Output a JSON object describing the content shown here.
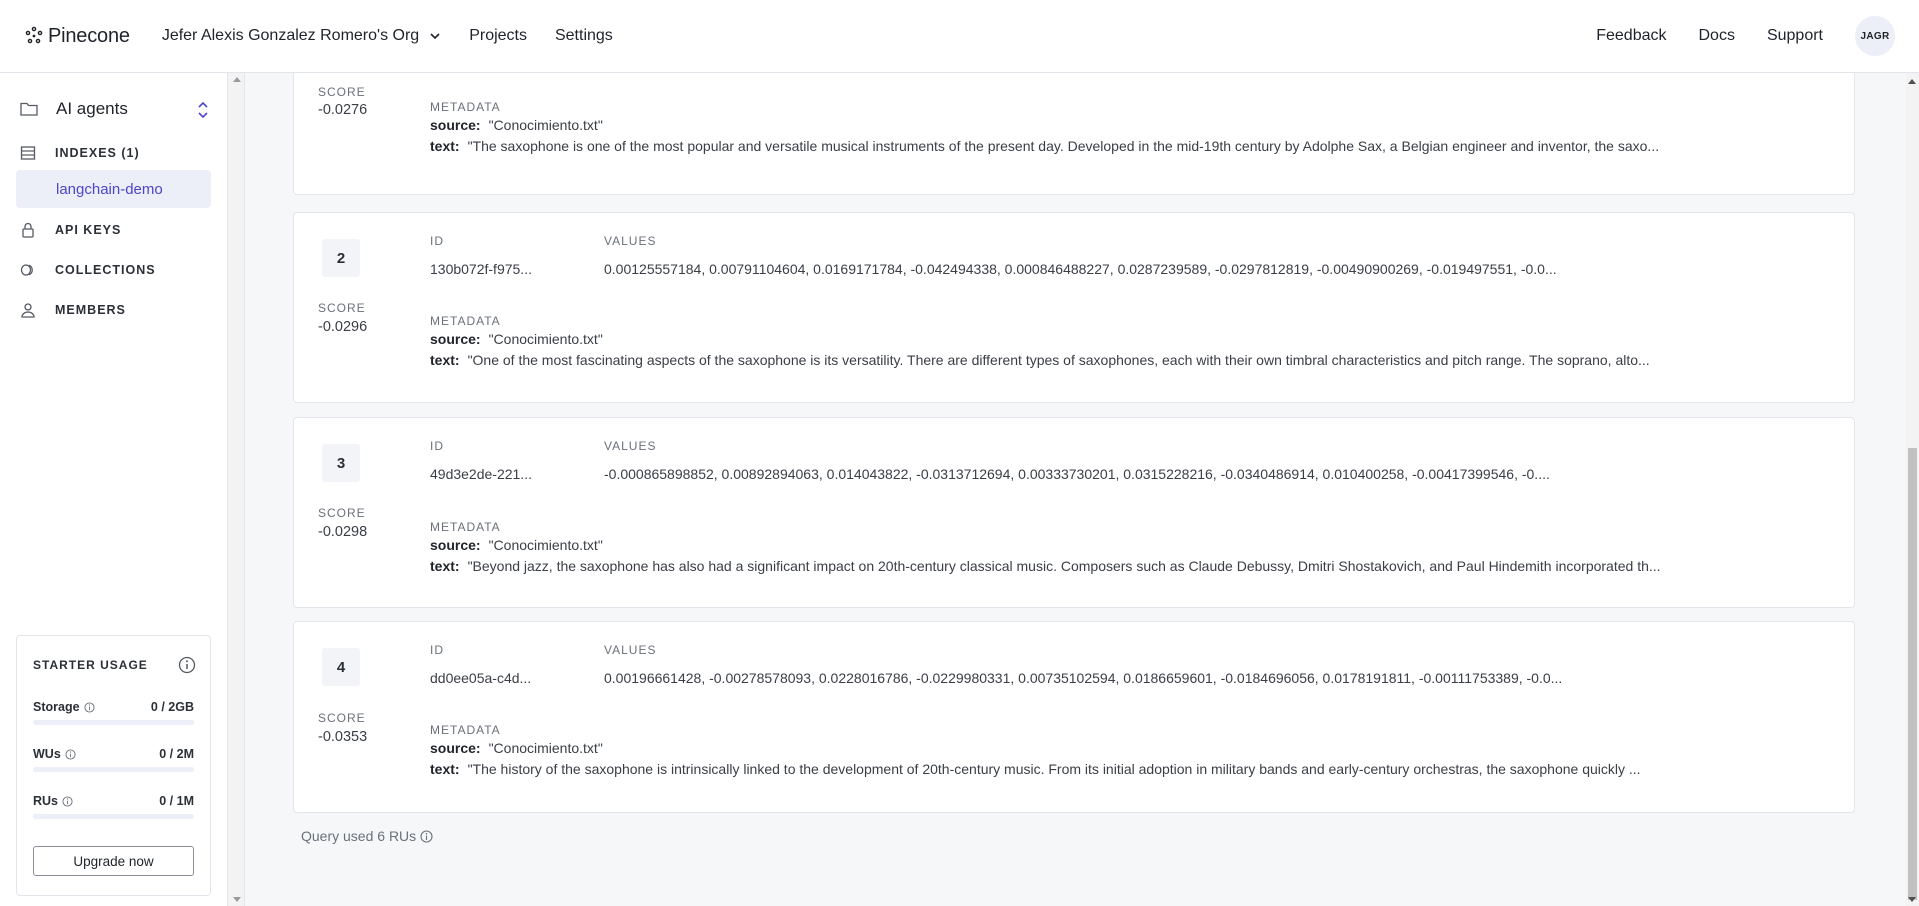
{
  "header": {
    "logo_text": "Pinecone",
    "org_name": "Jefer Alexis Gonzalez Romero's Org",
    "nav": [
      "Projects",
      "Settings"
    ],
    "right_nav": [
      "Feedback",
      "Docs",
      "Support"
    ],
    "avatar_initials": "JAGR"
  },
  "sidebar": {
    "project_name": "AI agents",
    "items": [
      {
        "label": "INDEXES (1)",
        "icon": "table-icon"
      },
      {
        "label": "langchain-demo"
      },
      {
        "label": "API KEYS",
        "icon": "lock-icon"
      },
      {
        "label": "COLLECTIONS",
        "icon": "collections-icon"
      },
      {
        "label": "MEMBERS",
        "icon": "user-icon"
      }
    ],
    "usage": {
      "title": "STARTER USAGE",
      "rows": [
        {
          "label": "Storage",
          "value": "0 / 2GB",
          "fraction": 0
        },
        {
          "label": "WUs",
          "value": "0 / 2M",
          "fraction": 0
        },
        {
          "label": "RUs",
          "value": "0 / 1M",
          "fraction": 0
        }
      ],
      "upgrade_label": "Upgrade now"
    }
  },
  "labels": {
    "score": "SCORE",
    "id": "ID",
    "values": "VALUES",
    "metadata": "METADATA",
    "source": "source:",
    "text": "text:"
  },
  "results": [
    {
      "score": "-0.0276",
      "source": "\"Conocimiento.txt\"",
      "text": "\"The saxophone is one of the most popular and versatile musical instruments of the present day. Developed in the mid-19th century by Adolphe Sax, a Belgian engineer and inventor, the saxo..."
    },
    {
      "rank": "2",
      "score": "-0.0296",
      "id": "130b072f-f975...",
      "values": "0.00125557184, 0.00791104604, 0.0169171784, -0.042494338, 0.000846488227, 0.0287239589, -0.0297812819, -0.00490900269, -0.019497551, -0.0...",
      "source": "\"Conocimiento.txt\"",
      "text": "\"One of the most fascinating aspects of the saxophone is its versatility. There are different types of saxophones, each with their own timbral characteristics and pitch range. The soprano, alto..."
    },
    {
      "rank": "3",
      "score": "-0.0298",
      "id": "49d3e2de-221...",
      "values": "-0.000865898852, 0.00892894063, 0.014043822, -0.0313712694, 0.00333730201, 0.0315228216, -0.0340486914, 0.010400258, -0.00417399546, -0....",
      "source": "\"Conocimiento.txt\"",
      "text": "\"Beyond jazz, the saxophone has also had a significant impact on 20th-century classical music. Composers such as Claude Debussy, Dmitri Shostakovich, and Paul Hindemith incorporated th..."
    },
    {
      "rank": "4",
      "score": "-0.0353",
      "id": "dd0ee05a-c4d...",
      "values": "0.00196661428, -0.00278578093, 0.0228016786, -0.0229980331, 0.00735102594, 0.0186659601, -0.0184696056, 0.0178191811, -0.00111753389, -0.0...",
      "source": "\"Conocimiento.txt\"",
      "text": "\"The history of the saxophone is intrinsically linked to the development of 20th-century music. From its initial adoption in military bands and early-century orchestras, the saxophone quickly ..."
    }
  ],
  "footer_note": "Query used 6 RUs"
}
